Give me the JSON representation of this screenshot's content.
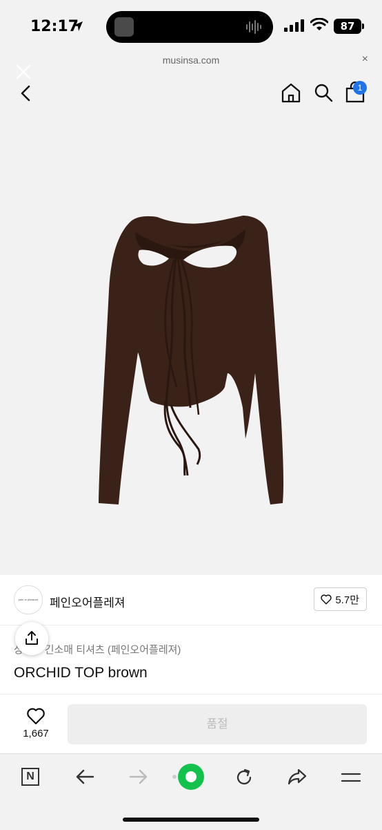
{
  "status_bar": {
    "time": "12:17",
    "battery": "87"
  },
  "browser": {
    "url": "musinsa.com",
    "close_glyph": "×"
  },
  "nav": {
    "cart_count": "1"
  },
  "brand": {
    "logo_text": "pain or pleasure",
    "name": "페인오어플레져",
    "likes": "5.7만"
  },
  "product": {
    "category": "상의 > 긴소매 티셔츠 (페인오어플레져)",
    "title": "ORCHID TOP brown",
    "image_icon": "brown-cutout-long-sleeve-top"
  },
  "buy_bar": {
    "like_count": "1,667",
    "soldout_label": "품절"
  },
  "toolbar": {
    "n_label": "N"
  },
  "colors": {
    "accent_blue": "#1e74e8",
    "naver_green": "#12c24d",
    "product_brown": "#3b2219"
  }
}
